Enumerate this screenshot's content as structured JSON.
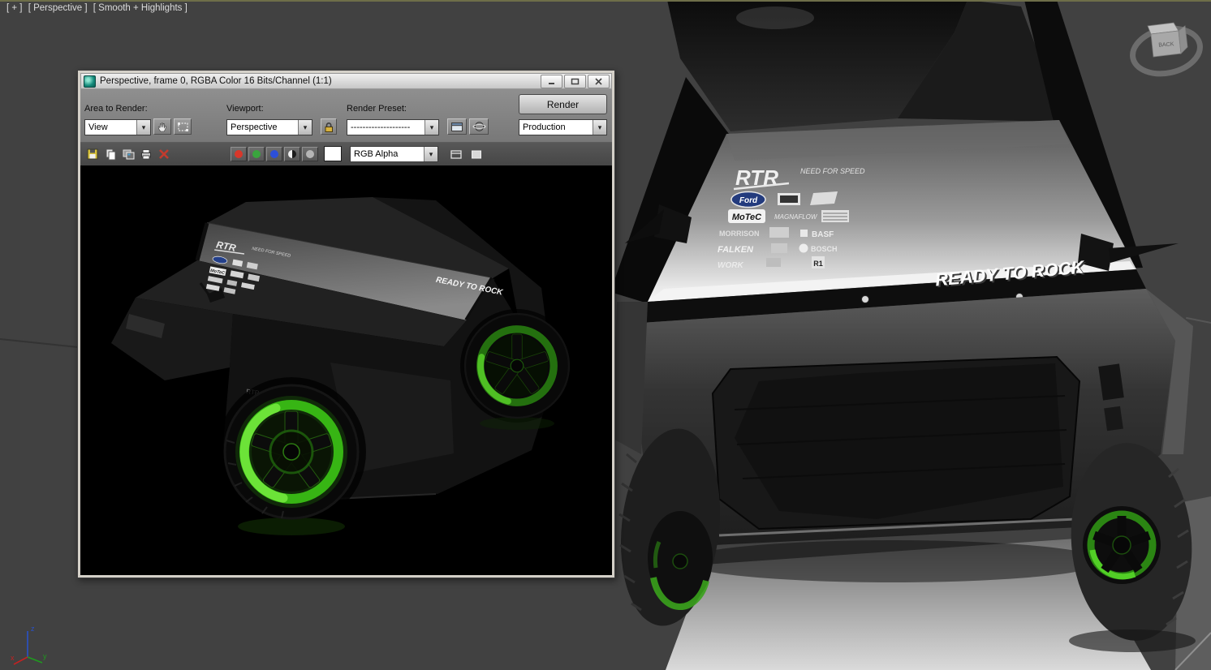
{
  "colors": {
    "viewport_bg": "#414141",
    "wheel_green": "#3fae1e",
    "wheel_green_bright": "#6fe63a",
    "window_chrome": "#d4d0c8",
    "toolbar_gray": "#808080",
    "toolbar_dark": "#4a4a4a",
    "canvas_black": "#000000",
    "channel_red": "#d8372a",
    "channel_green": "#3aa43e",
    "channel_blue": "#2c4fd8"
  },
  "icons": {
    "dropdown_arrow": "▾"
  },
  "viewport": {
    "menu_general": "[ + ]",
    "menu_pov": "[ Perspective ]",
    "menu_shading": "[ Smooth + Highlights ]",
    "viewcube_label": "BACK",
    "axis_x": "x",
    "axis_y": "y",
    "axis_z": "z"
  },
  "render_window": {
    "title": "Perspective, frame 0, RGBA Color 16 Bits/Channel (1:1)",
    "area_to_render_label": "Area to Render:",
    "area_to_render_value": "View",
    "viewport_label": "Viewport:",
    "viewport_value": "Perspective",
    "render_preset_label": "Render Preset:",
    "render_preset_value": "--------------------",
    "render_button": "Render",
    "render_mode_value": "Production",
    "channel_display_value": "RGB Alpha"
  },
  "render_image": {
    "banner": "READY TO ROCK"
  },
  "scene": {
    "banner": "READY TO ROCK",
    "decals": {
      "rtr": "RTR",
      "nfs": "NEED FOR SPEED",
      "ford": "Ford",
      "motec": "MoTeC",
      "magnaflow": "MAGNAFLOW",
      "morrison": "MORRISON",
      "basf": "BASF",
      "bosch": "BOSCH",
      "falken": "FALKEN",
      "work": "WORK",
      "r1": "R1"
    }
  }
}
